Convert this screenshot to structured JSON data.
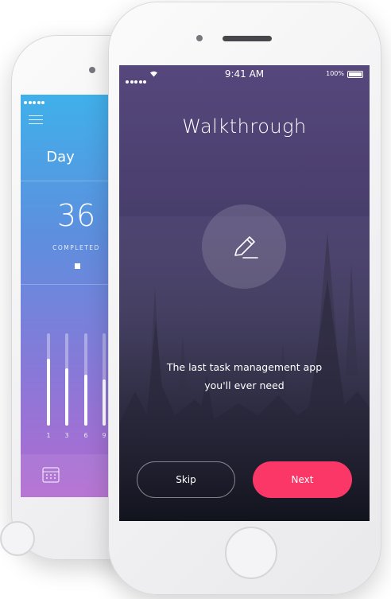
{
  "back_phone": {
    "day_label": "Day",
    "completed_count": "36",
    "completed_label": "COMPLETED",
    "bars": [
      {
        "label": "1",
        "fill": 0.72
      },
      {
        "label": "3",
        "fill": 0.62
      },
      {
        "label": "6",
        "fill": 0.55
      },
      {
        "label": "9",
        "fill": 0.5
      }
    ],
    "footer_icon": "calendar-icon"
  },
  "status_bar": {
    "time": "9:41 AM",
    "battery": "100%"
  },
  "walkthrough": {
    "title": "Walkthrough",
    "icon": "pencil-icon",
    "tagline_line1": "The last task management app",
    "tagline_line2": "you'll ever need",
    "skip_label": "Skip",
    "next_label": "Next",
    "next_color": "#fb3768"
  }
}
